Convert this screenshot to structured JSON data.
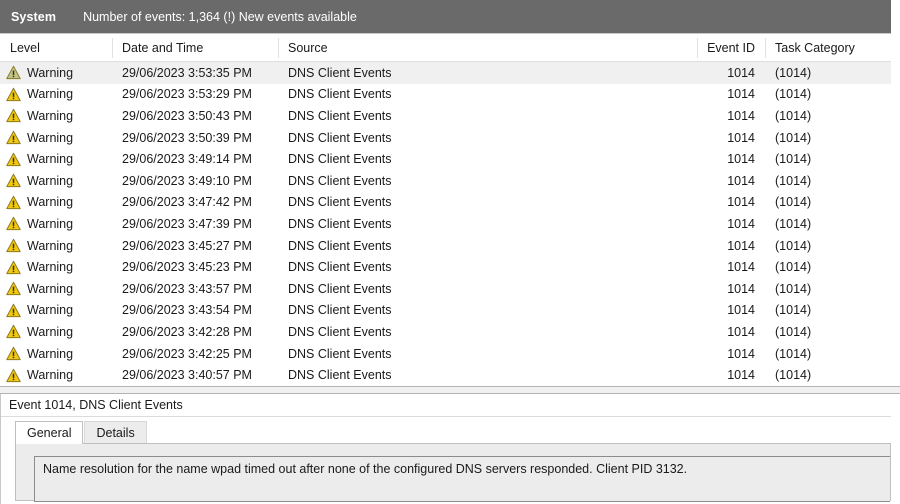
{
  "topbar": {
    "log_name": "System",
    "events_summary": "Number of events: 1,364 (!) New events available"
  },
  "event_list": {
    "columns": [
      {
        "key": "level",
        "label": "Level"
      },
      {
        "key": "datetime",
        "label": "Date and Time"
      },
      {
        "key": "source",
        "label": "Source"
      },
      {
        "key": "event_id",
        "label": "Event ID"
      },
      {
        "key": "task_category",
        "label": "Task Category"
      }
    ],
    "rows": [
      {
        "level": "Warning",
        "icon": "warning-icon",
        "datetime": "29/06/2023 3:53:35 PM",
        "source": "DNS Client Events",
        "event_id": "1014",
        "task_category": "(1014)",
        "selected": true
      },
      {
        "level": "Warning",
        "icon": "warning-icon",
        "datetime": "29/06/2023 3:53:29 PM",
        "source": "DNS Client Events",
        "event_id": "1014",
        "task_category": "(1014)",
        "selected": false
      },
      {
        "level": "Warning",
        "icon": "warning-icon",
        "datetime": "29/06/2023 3:50:43 PM",
        "source": "DNS Client Events",
        "event_id": "1014",
        "task_category": "(1014)",
        "selected": false
      },
      {
        "level": "Warning",
        "icon": "warning-icon",
        "datetime": "29/06/2023 3:50:39 PM",
        "source": "DNS Client Events",
        "event_id": "1014",
        "task_category": "(1014)",
        "selected": false
      },
      {
        "level": "Warning",
        "icon": "warning-icon",
        "datetime": "29/06/2023 3:49:14 PM",
        "source": "DNS Client Events",
        "event_id": "1014",
        "task_category": "(1014)",
        "selected": false
      },
      {
        "level": "Warning",
        "icon": "warning-icon",
        "datetime": "29/06/2023 3:49:10 PM",
        "source": "DNS Client Events",
        "event_id": "1014",
        "task_category": "(1014)",
        "selected": false
      },
      {
        "level": "Warning",
        "icon": "warning-icon",
        "datetime": "29/06/2023 3:47:42 PM",
        "source": "DNS Client Events",
        "event_id": "1014",
        "task_category": "(1014)",
        "selected": false
      },
      {
        "level": "Warning",
        "icon": "warning-icon",
        "datetime": "29/06/2023 3:47:39 PM",
        "source": "DNS Client Events",
        "event_id": "1014",
        "task_category": "(1014)",
        "selected": false
      },
      {
        "level": "Warning",
        "icon": "warning-icon",
        "datetime": "29/06/2023 3:45:27 PM",
        "source": "DNS Client Events",
        "event_id": "1014",
        "task_category": "(1014)",
        "selected": false
      },
      {
        "level": "Warning",
        "icon": "warning-icon",
        "datetime": "29/06/2023 3:45:23 PM",
        "source": "DNS Client Events",
        "event_id": "1014",
        "task_category": "(1014)",
        "selected": false
      },
      {
        "level": "Warning",
        "icon": "warning-icon",
        "datetime": "29/06/2023 3:43:57 PM",
        "source": "DNS Client Events",
        "event_id": "1014",
        "task_category": "(1014)",
        "selected": false
      },
      {
        "level": "Warning",
        "icon": "warning-icon",
        "datetime": "29/06/2023 3:43:54 PM",
        "source": "DNS Client Events",
        "event_id": "1014",
        "task_category": "(1014)",
        "selected": false
      },
      {
        "level": "Warning",
        "icon": "warning-icon",
        "datetime": "29/06/2023 3:42:28 PM",
        "source": "DNS Client Events",
        "event_id": "1014",
        "task_category": "(1014)",
        "selected": false
      },
      {
        "level": "Warning",
        "icon": "warning-icon",
        "datetime": "29/06/2023 3:42:25 PM",
        "source": "DNS Client Events",
        "event_id": "1014",
        "task_category": "(1014)",
        "selected": false
      },
      {
        "level": "Warning",
        "icon": "warning-icon",
        "datetime": "29/06/2023 3:40:57 PM",
        "source": "DNS Client Events",
        "event_id": "1014",
        "task_category": "(1014)",
        "selected": false
      }
    ]
  },
  "detail": {
    "title": "Event 1014, DNS Client Events",
    "tabs": [
      {
        "label": "General",
        "active": true
      },
      {
        "label": "Details",
        "active": false
      }
    ],
    "message": "Name resolution for the name wpad timed out after none of the configured DNS servers responded. Client PID 3132."
  },
  "colors": {
    "topbar_bg": "#6a6a6a",
    "topbar_text": "#ffffff",
    "selected_row_bg": "#f0f0f0",
    "warning_yellow": "#f2c811",
    "warning_yellow_muted": "#bfc48a",
    "text": "#1a1a1a",
    "panel_bg": "#ececec"
  }
}
